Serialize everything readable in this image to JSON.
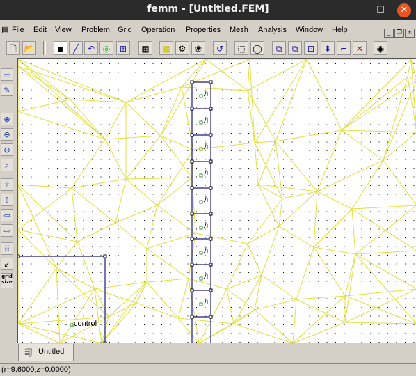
{
  "window": {
    "title": "femm - [Untitled.FEM]"
  },
  "menu": [
    "File",
    "Edit",
    "View",
    "Problem",
    "Grid",
    "Operation",
    "Properties",
    "Mesh",
    "Analysis",
    "Window",
    "Help"
  ],
  "canvas": {
    "label": "control"
  },
  "tabs": [
    {
      "label": "Untitled"
    }
  ],
  "status": {
    "coords": "(r=9.6000,z=0.0000)"
  },
  "lefttoolbar": {
    "grid_label": "grid size"
  },
  "colors": {
    "mesh": "#e0e040",
    "geometry": "#1a1a80",
    "node": "#000000",
    "block_label": "#2b8a2b"
  },
  "icons": [
    "new-icon",
    "open-icon",
    "point-icon",
    "segment-icon",
    "arc-icon",
    "block-label-icon",
    "group-icon",
    "props-icon",
    "select-icon",
    "gear-icon",
    "mesh-icon",
    "undo-icon",
    "rect-select-icon",
    "circle-select-icon",
    "copy-icon",
    "move-icon",
    "scale-icon",
    "mirror-icon",
    "fillet-icon",
    "delete-icon",
    "run-icon"
  ]
}
